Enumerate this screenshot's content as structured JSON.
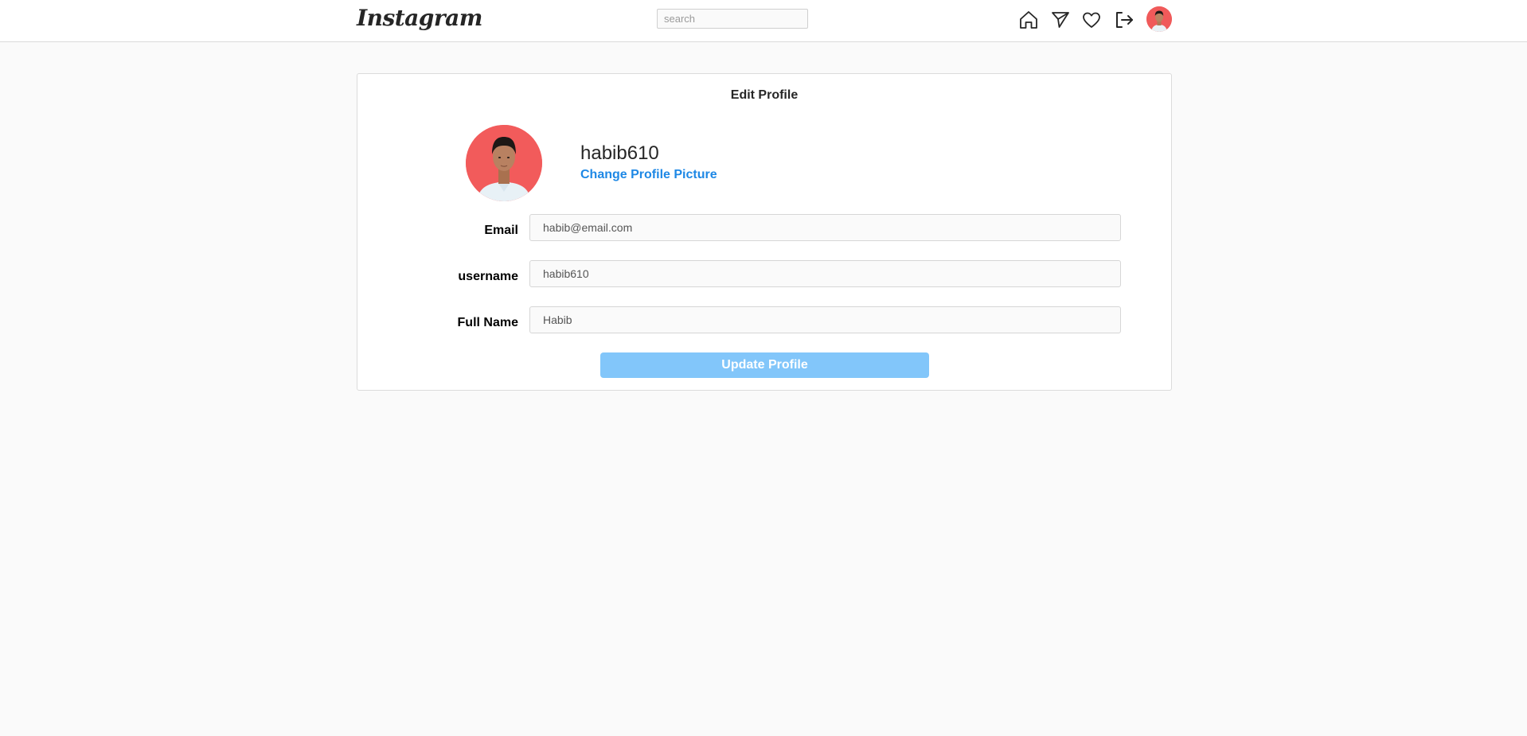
{
  "header": {
    "logo": "Instagram",
    "search_placeholder": "search",
    "nav_icons": [
      "home-icon",
      "send-icon",
      "heart-icon",
      "logout-icon"
    ]
  },
  "edit_profile": {
    "title": "Edit Profile",
    "username_display": "habib610",
    "change_picture_label": "Change Profile Picture",
    "fields": {
      "email": {
        "label": "Email",
        "value": "habib@email.com"
      },
      "username": {
        "label": "username",
        "value": "habib610"
      },
      "full_name": {
        "label": "Full Name",
        "value": "Habib"
      }
    },
    "submit_label": "Update Profile"
  },
  "colors": {
    "accent_link": "#1e88e5",
    "button_disabled": "#82c6fa",
    "avatar_background": "#f25b5b",
    "page_background": "#fafafa"
  }
}
